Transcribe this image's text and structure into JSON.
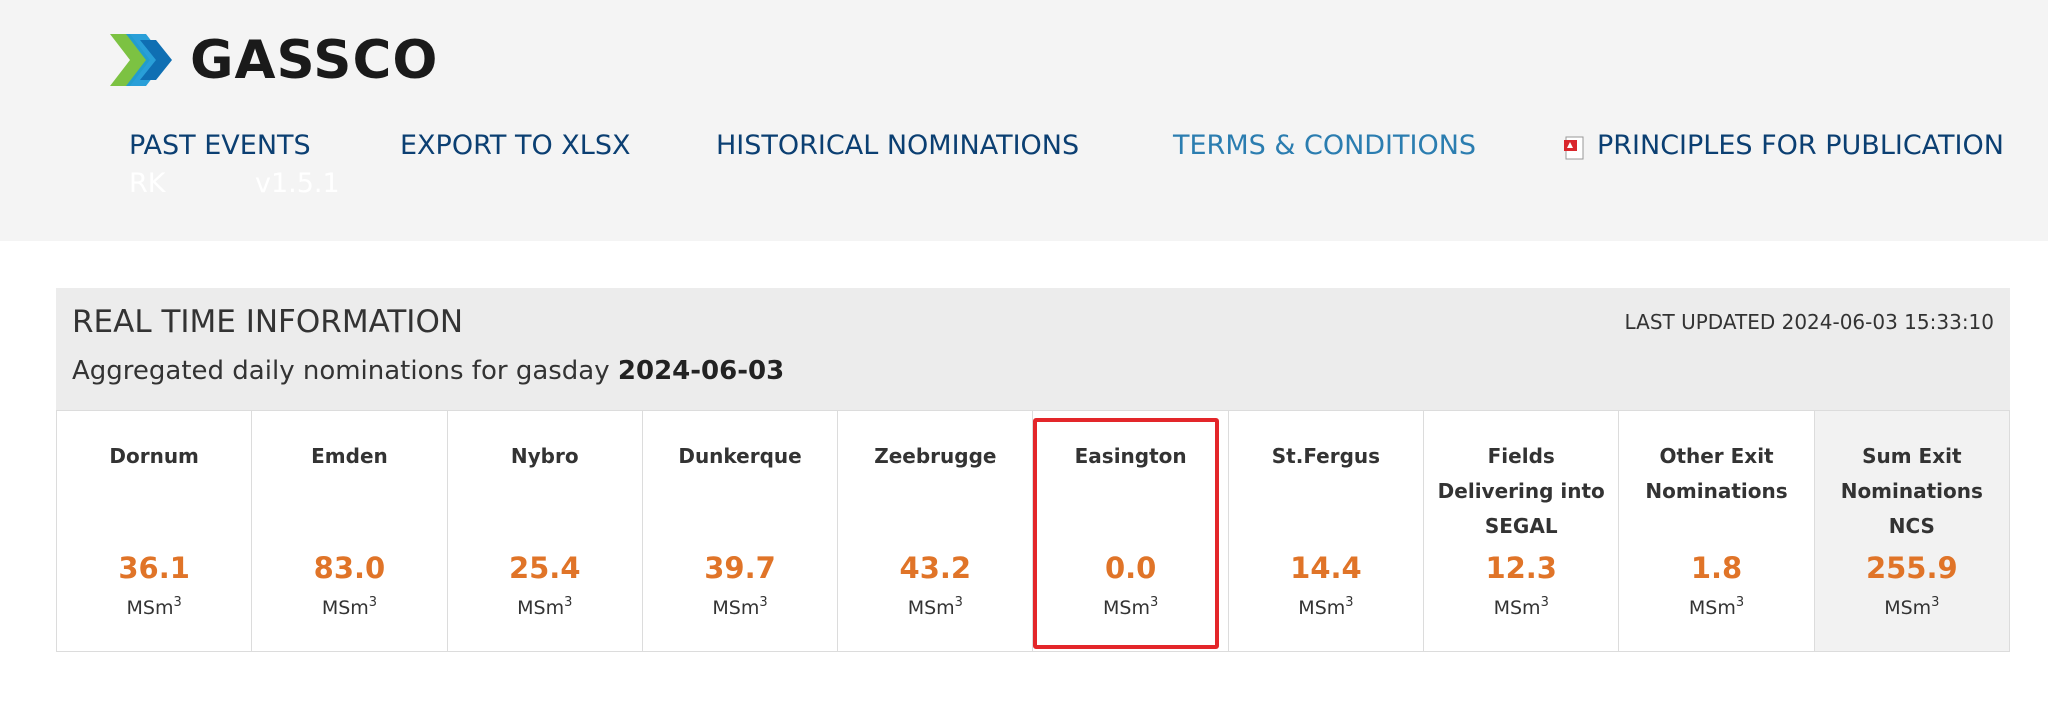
{
  "brand": {
    "name": "GASSCO"
  },
  "nav": {
    "items": [
      {
        "label": "PAST EVENTS"
      },
      {
        "label": "EXPORT TO XLSX"
      },
      {
        "label": "HISTORICAL NOMINATIONS"
      },
      {
        "label": "TERMS & CONDITIONS"
      },
      {
        "label": "PRINCIPLES FOR PUBLICATION"
      }
    ]
  },
  "ghost": {
    "left": "RK",
    "version": "v1.5.1"
  },
  "panel": {
    "title": "REAL TIME INFORMATION",
    "subtitle_prefix": "Aggregated daily nominations for gasday",
    "gasday": "2024-06-03",
    "last_updated": "LAST UPDATED 2024-06-03 15:33:10"
  },
  "unit": "MSm",
  "unit_sup": "3",
  "cells": [
    {
      "name": "Dornum",
      "value": "36.1"
    },
    {
      "name": "Emden",
      "value": "83.0"
    },
    {
      "name": "Nybro",
      "value": "25.4"
    },
    {
      "name": "Dunkerque",
      "value": "39.7"
    },
    {
      "name": "Zeebrugge",
      "value": "43.2"
    },
    {
      "name": "Easington",
      "value": "0.0"
    },
    {
      "name": "St.Fergus",
      "value": "14.4"
    },
    {
      "name": "Fields Delivering into SEGAL",
      "value": "12.3"
    },
    {
      "name": "Other Exit Nominations",
      "value": "1.8"
    },
    {
      "name": "Sum Exit Nominations NCS",
      "value": "255.9"
    }
  ],
  "colors": {
    "value": "#e07428",
    "nav": "#0b3f72",
    "nav_active": "#2b7db0",
    "highlight": "#e3262a"
  }
}
